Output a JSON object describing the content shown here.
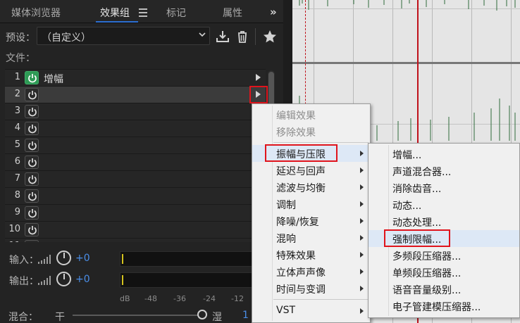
{
  "tabs": {
    "media_browser": "媒体浏览器",
    "effects_rack": "效果组",
    "markers": "标记",
    "properties": "属性",
    "overflow": "»"
  },
  "preset": {
    "label": "预设：",
    "value": "（自定义）"
  },
  "files_label": "文件：",
  "rack": {
    "rows": [
      {
        "num": "1",
        "name": "增幅",
        "on": true
      },
      {
        "num": "2",
        "name": "",
        "on": false
      },
      {
        "num": "3",
        "name": "",
        "on": false
      },
      {
        "num": "4",
        "name": "",
        "on": false
      },
      {
        "num": "5",
        "name": "",
        "on": false
      },
      {
        "num": "6",
        "name": "",
        "on": false
      },
      {
        "num": "7",
        "name": "",
        "on": false
      },
      {
        "num": "8",
        "name": "",
        "on": false
      },
      {
        "num": "9",
        "name": "",
        "on": false
      },
      {
        "num": "10",
        "name": "",
        "on": false
      },
      {
        "num": "11",
        "name": "",
        "on": false
      }
    ]
  },
  "io": {
    "input_label": "输入：",
    "input_value": "+0",
    "output_label": "输出：",
    "output_value": "+0",
    "db_scale": [
      "dB",
      "-48",
      "-36",
      "-24",
      "-12"
    ]
  },
  "mix": {
    "label": "混合：",
    "dry": "干",
    "wet": "湿",
    "value": "1"
  },
  "context_menu": {
    "edit_effect": "编辑效果",
    "remove_effect": "移除效果",
    "categories": [
      "振幅与压限",
      "延迟与回声",
      "滤波与均衡",
      "调制",
      "降噪/恢复",
      "混响",
      "特殊效果",
      "立体声声像",
      "时间与变调",
      "VST"
    ]
  },
  "submenu": {
    "items": [
      "增幅...",
      "声道混合器...",
      "消除齿音...",
      "动态...",
      "动态处理...",
      "强制限幅...",
      "多频段压缩器...",
      "单频段压缩器...",
      "语音音量级别...",
      "电子管建模压缩器..."
    ]
  },
  "colors": {
    "accent_blue": "#4a8ee8",
    "power_on": "#2e9a55",
    "highlight_red": "#e0141c",
    "playhead": "#c0121b"
  }
}
